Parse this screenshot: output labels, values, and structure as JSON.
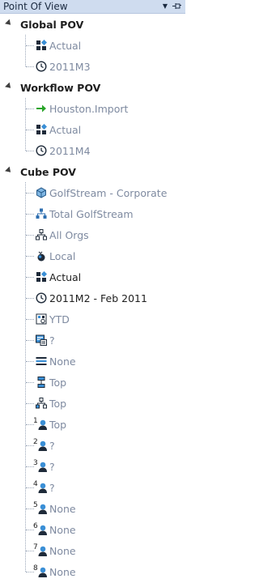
{
  "panel": {
    "title": "Point Of View",
    "menu_glyph": "▼",
    "pin_glyph": "⊸"
  },
  "sections": [
    {
      "label": "Global POV",
      "items": [
        {
          "label": "Actual",
          "icon": "scenario-icon",
          "style": "gray"
        },
        {
          "label": "2011M3",
          "icon": "clock-icon",
          "style": "gray"
        }
      ]
    },
    {
      "label": "Workflow POV",
      "items": [
        {
          "label": "Houston.Import",
          "icon": "green-arrow-icon",
          "style": "gray"
        },
        {
          "label": "Actual",
          "icon": "scenario-icon",
          "style": "gray"
        },
        {
          "label": "2011M4",
          "icon": "clock-icon",
          "style": "gray"
        }
      ]
    },
    {
      "label": "Cube POV",
      "items": [
        {
          "label": "GolfStream - Corporate",
          "icon": "cube-icon",
          "style": "gray"
        },
        {
          "label": "Total GolfStream",
          "icon": "hierarchy-icon",
          "style": "gray"
        },
        {
          "label": "All Orgs",
          "icon": "hierarchy-outline-icon",
          "style": "gray"
        },
        {
          "label": "Local",
          "icon": "currency-icon",
          "style": "gray"
        },
        {
          "label": "Actual",
          "icon": "scenario-icon",
          "style": "dark"
        },
        {
          "label": "2011M2 - Feb 2011",
          "icon": "clock-icon",
          "style": "dark"
        },
        {
          "label": "YTD",
          "icon": "view-icon",
          "style": "gray"
        },
        {
          "label": "?",
          "icon": "account-icon",
          "style": "gray"
        },
        {
          "label": "None",
          "icon": "flow-icon",
          "style": "gray"
        },
        {
          "label": "Top",
          "icon": "origin-icon",
          "style": "gray"
        },
        {
          "label": "Top",
          "icon": "ic-icon",
          "style": "gray"
        },
        {
          "label": "Top",
          "icon": "user-defined-1-icon",
          "style": "gray",
          "num": "1"
        },
        {
          "label": "?",
          "icon": "user-defined-2-icon",
          "style": "gray",
          "num": "2"
        },
        {
          "label": "?",
          "icon": "user-defined-3-icon",
          "style": "gray",
          "num": "3"
        },
        {
          "label": "?",
          "icon": "user-defined-4-icon",
          "style": "gray",
          "num": "4"
        },
        {
          "label": "None",
          "icon": "user-defined-5-icon",
          "style": "gray",
          "num": "5"
        },
        {
          "label": "None",
          "icon": "user-defined-6-icon",
          "style": "gray",
          "num": "6"
        },
        {
          "label": "None",
          "icon": "user-defined-7-icon",
          "style": "gray",
          "num": "7"
        },
        {
          "label": "None",
          "icon": "user-defined-8-icon",
          "style": "gray",
          "num": "8"
        }
      ]
    }
  ]
}
